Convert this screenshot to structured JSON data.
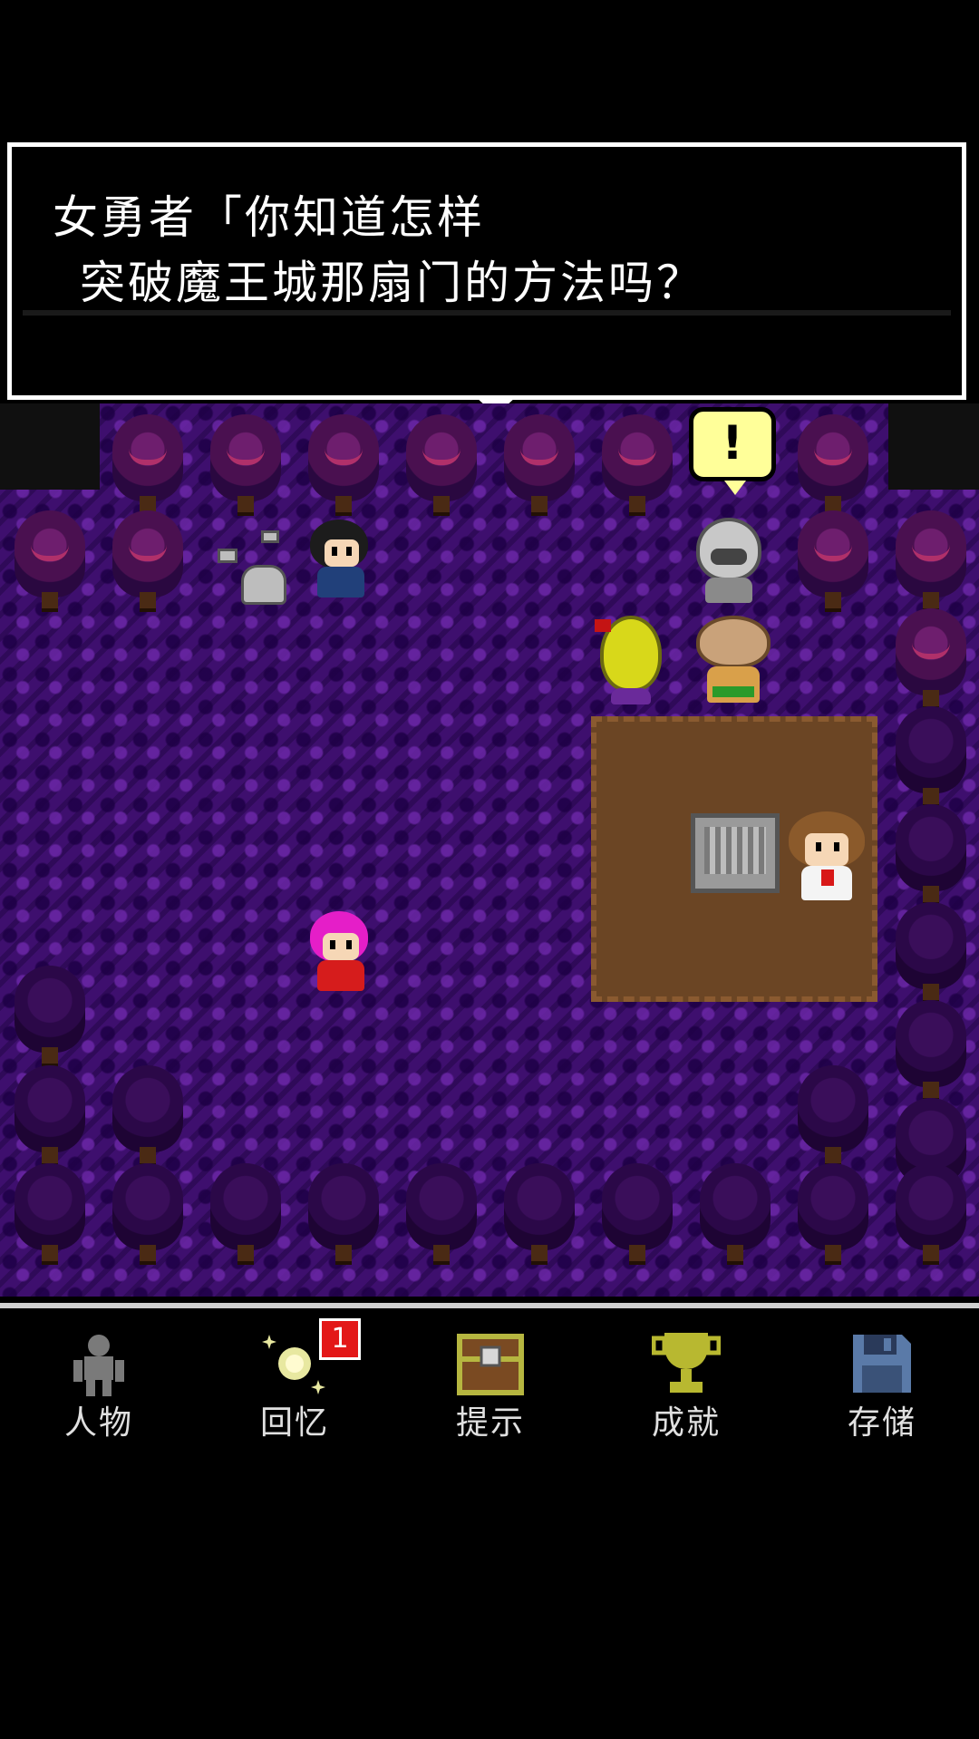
{
  "dialog": {
    "line1": "女勇者「你知道怎样",
    "line2": "突破魔王城那扇门的方法吗？",
    "continue_icon": "down-arrow-icon"
  },
  "scene": {
    "exclamation": "!"
  },
  "toolbar": {
    "items": [
      {
        "label": "人物",
        "icon": "person-icon"
      },
      {
        "label": "回忆",
        "icon": "memory-sparkle-icon",
        "badge": "1"
      },
      {
        "label": "提示",
        "icon": "treasure-chest-icon"
      },
      {
        "label": "成就",
        "icon": "trophy-icon"
      },
      {
        "label": "存储",
        "icon": "floppy-disk-icon"
      }
    ]
  },
  "colors": {
    "ground": "#3e0f6e",
    "dirt": "#6b4524",
    "badge": "#e31818",
    "bubble": "#ffff99"
  }
}
